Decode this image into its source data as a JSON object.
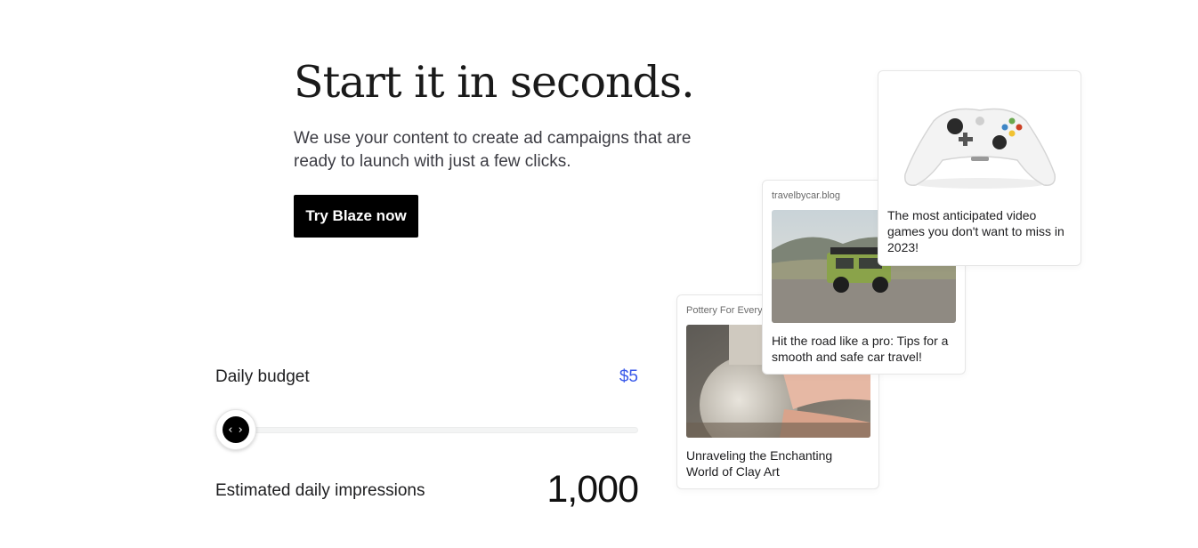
{
  "hero": {
    "title": "Start it in seconds.",
    "subtitle": "We use your content to create ad campaigns that are ready to launch with just a few clicks.",
    "cta_label": "Try Blaze now"
  },
  "budget": {
    "label": "Daily budget",
    "value": "$5",
    "slider_fraction": 0,
    "slider_thumb_glyph": "‹ ›"
  },
  "impressions": {
    "label": "Estimated daily impressions",
    "value": "1,000"
  },
  "cards": {
    "pottery": {
      "source": "Pottery For Everyo",
      "image": "vase-shaping-photo",
      "caption": "Unraveling the Enchanting World of Clay Art"
    },
    "travel": {
      "source": "travelbycar.blog",
      "image": "off-road-vehicle-photo",
      "caption": "Hit the road like a pro: Tips for a smooth and safe car travel!"
    },
    "games": {
      "image": "game-controller-photo",
      "caption": "The most anticipated video games you don't want to miss in 2023!"
    }
  },
  "colors": {
    "accent": "#3858e9",
    "button_bg": "#000000",
    "button_text": "#ffffff"
  }
}
